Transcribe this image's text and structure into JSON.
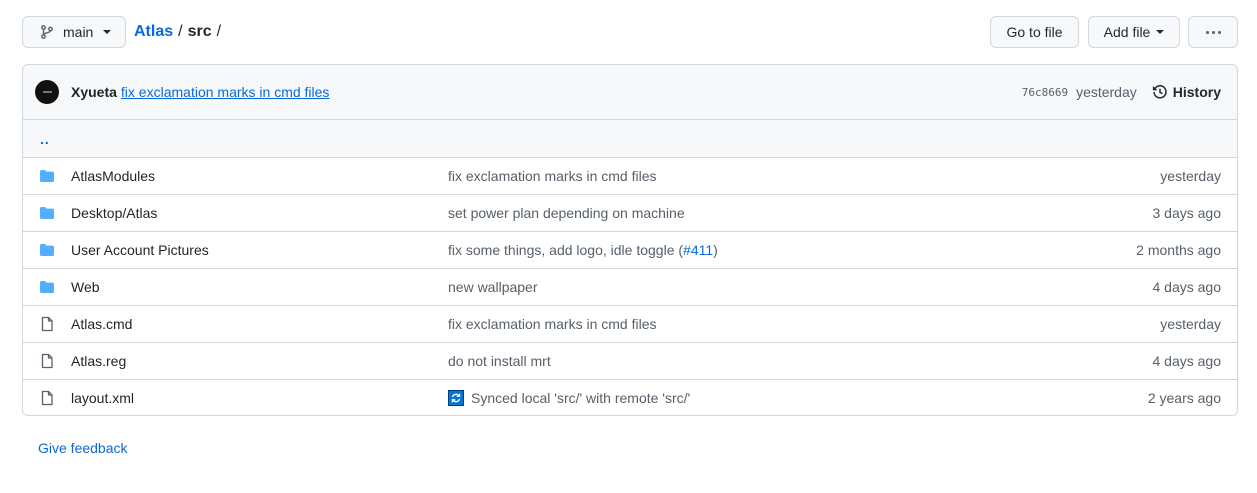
{
  "toolbar": {
    "branch": "main",
    "repo": "Atlas",
    "separator": "/",
    "directory": "src",
    "trailing_separator": "/",
    "go_to_file": "Go to file",
    "add_file": "Add file"
  },
  "latest_commit": {
    "author": "Xyueta",
    "message": "fix exclamation marks in cmd files",
    "sha": "76c8669",
    "when": "yesterday",
    "history_label": "History"
  },
  "parent_link": "..",
  "files": [
    {
      "type": "folder",
      "name": "AtlasModules",
      "message": "fix exclamation marks in cmd files",
      "age": "yesterday"
    },
    {
      "type": "folder",
      "name": "Desktop/Atlas",
      "message": "set power plan depending on machine",
      "age": "3 days ago"
    },
    {
      "type": "folder",
      "name": "User Account Pictures",
      "message": "fix some things, add logo, idle toggle (",
      "pr": "#411",
      "message_end": ")",
      "age": "2 months ago"
    },
    {
      "type": "folder",
      "name": "Web",
      "message": "new wallpaper",
      "age": "4 days ago"
    },
    {
      "type": "file",
      "name": "Atlas.cmd",
      "message": "fix exclamation marks in cmd files",
      "age": "yesterday"
    },
    {
      "type": "file",
      "name": "Atlas.reg",
      "message": "do not install mrt",
      "age": "4 days ago"
    },
    {
      "type": "file",
      "name": "layout.xml",
      "message": "Synced local 'src/' with remote 'src/'",
      "age": "2 years ago",
      "badge_icon": "sync-icon"
    }
  ],
  "feedback_link": "Give feedback",
  "colors": {
    "link": "#0969da",
    "folder": "#54aeff",
    "muted": "#57606a",
    "border": "#d0d7de",
    "subtle_bg": "#f6f8fa"
  }
}
